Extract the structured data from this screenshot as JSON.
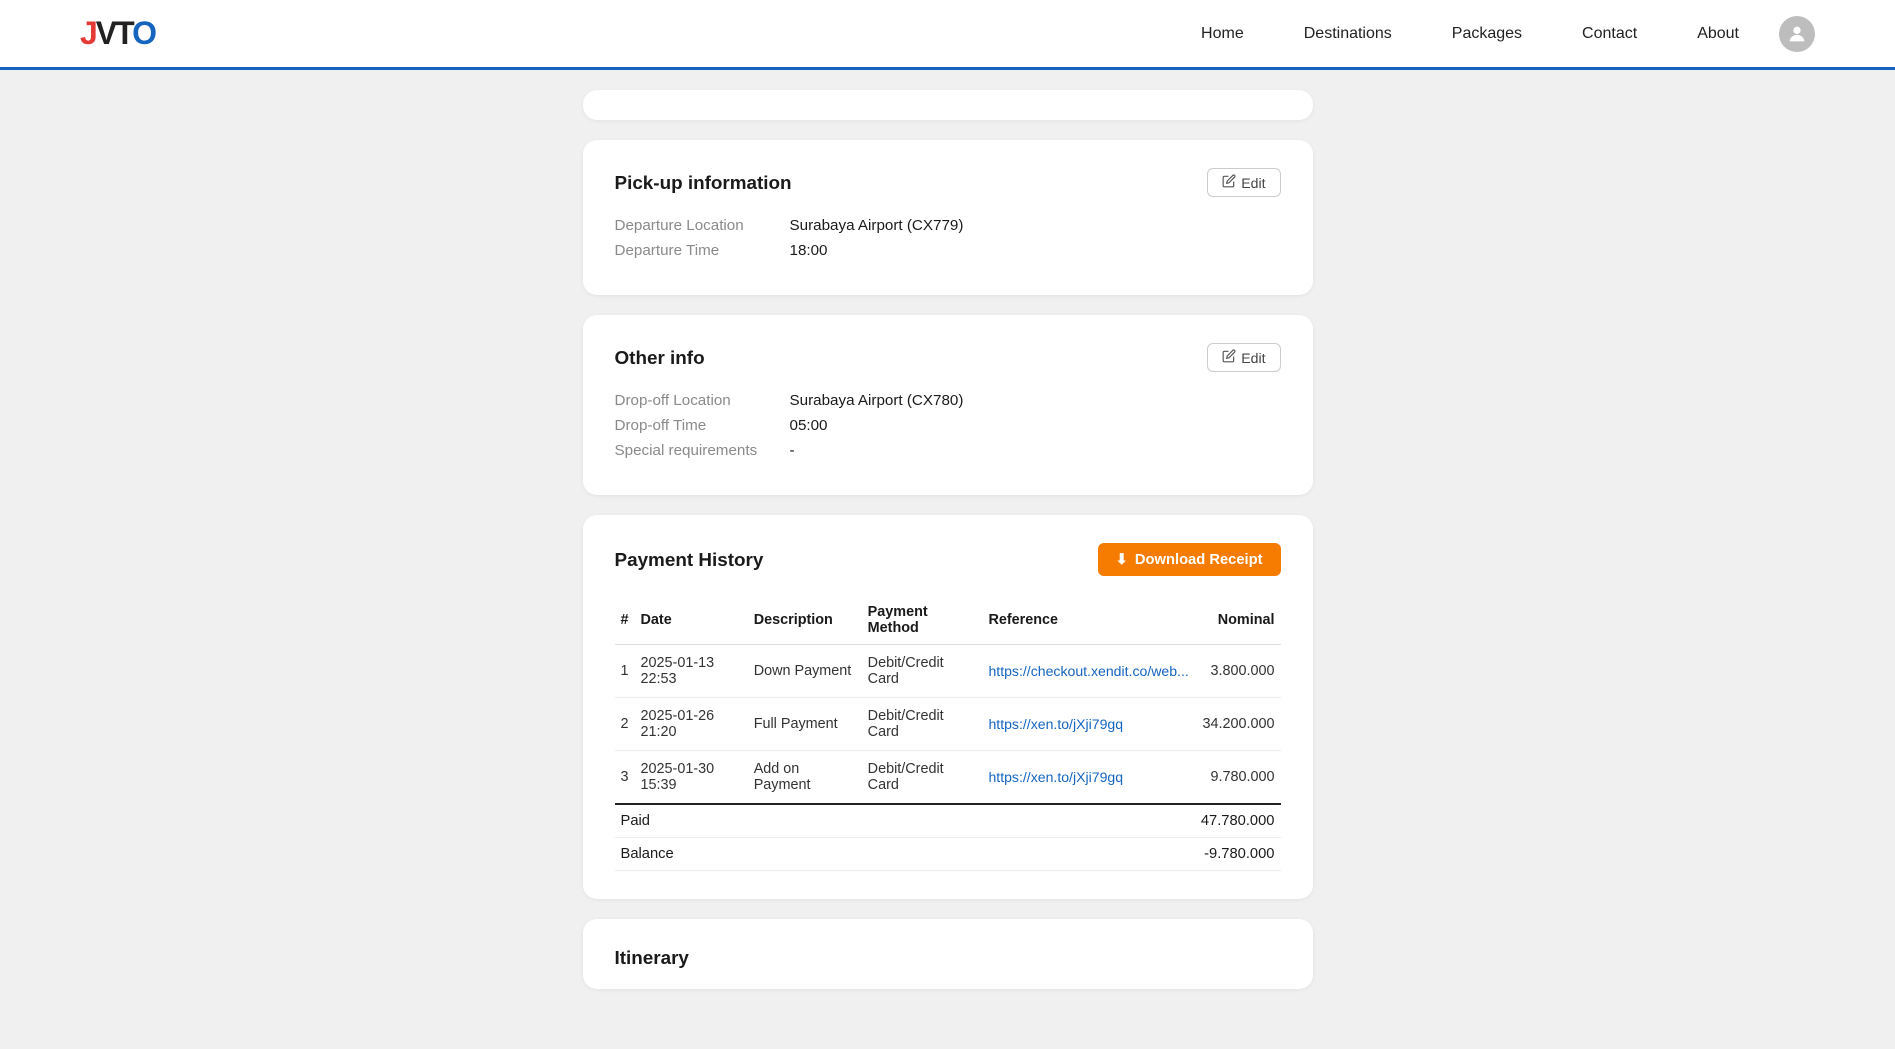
{
  "navbar": {
    "logo": {
      "j": "J",
      "v": "V",
      "t": "T",
      "o": "O"
    },
    "links": [
      {
        "id": "home",
        "label": "Home"
      },
      {
        "id": "destinations",
        "label": "Destinations"
      },
      {
        "id": "packages",
        "label": "Packages"
      },
      {
        "id": "contact",
        "label": "Contact"
      },
      {
        "id": "about",
        "label": "About"
      }
    ]
  },
  "pickup_section": {
    "title": "Pick-up information",
    "edit_label": "Edit",
    "fields": [
      {
        "label": "Departure Location",
        "value": "Surabaya Airport (CX779)"
      },
      {
        "label": "Departure Time",
        "value": "18:00"
      }
    ]
  },
  "otherinfo_section": {
    "title": "Other info",
    "edit_label": "Edit",
    "fields": [
      {
        "label": "Drop-off Location",
        "value": "Surabaya Airport (CX780)"
      },
      {
        "label": "Drop-off Time",
        "value": "05:00"
      },
      {
        "label": "Special requirements",
        "value": "-"
      }
    ]
  },
  "payment_section": {
    "title": "Payment History",
    "download_label": "Download Receipt",
    "download_icon": "⬇",
    "table_headers": [
      "#",
      "Date",
      "Description",
      "Payment Method",
      "Reference",
      "Nominal"
    ],
    "rows": [
      {
        "num": "1",
        "date": "2025-01-13 22:53",
        "description": "Down Payment",
        "method": "Debit/Credit Card",
        "reference": "https://checkout.xendit.co/web...",
        "reference_full": "https://checkout.xendit.co/web...",
        "nominal": "3.800.000"
      },
      {
        "num": "2",
        "date": "2025-01-26 21:20",
        "description": "Full Payment",
        "method": "Debit/Credit Card",
        "reference": "https://xen.to/jXji79gq",
        "reference_full": "https://xen.to/jXji79gq",
        "nominal": "34.200.000"
      },
      {
        "num": "3",
        "date": "2025-01-30 15:39",
        "description": "Add on Payment",
        "method": "Debit/Credit Card",
        "reference": "https://xen.to/jXji79gq",
        "reference_full": "https://xen.to/jXji79gq",
        "nominal": "9.780.000"
      }
    ],
    "paid_label": "Paid",
    "paid_value": "47.780.000",
    "balance_label": "Balance",
    "balance_value": "-9.780.000"
  },
  "itinerary_section": {
    "title": "Itinerary"
  }
}
